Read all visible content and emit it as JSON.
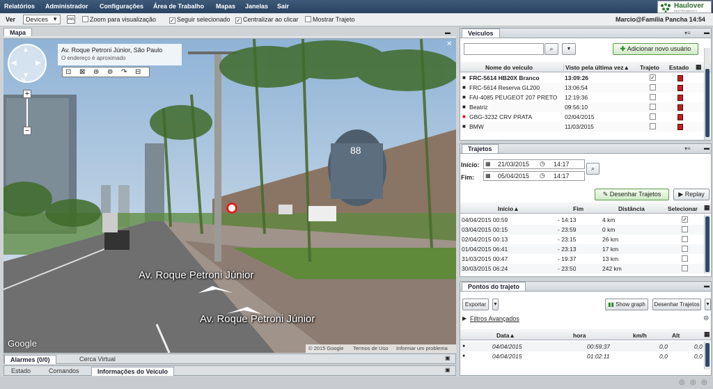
{
  "menubar": {
    "items": [
      "Relatórios",
      "Administrador",
      "Configurações",
      "Área de Trabalho",
      "Mapas",
      "Janelas",
      "Sair"
    ],
    "brand": "Haulover",
    "brand_sub": "RASTREAMENTO"
  },
  "toolbar": {
    "ver_label": "Ver",
    "devices_value": "Devices",
    "zoom_label": "Zoom para visualização",
    "seguir_label": "Seguir selecionado",
    "centralizar_label": "Centralizar ao clicar",
    "mostrar_label": "Mostrar Trajeto",
    "user_time": "Marcio@Família Pancha 14:54"
  },
  "map": {
    "tab": "Mapa",
    "address_title": "Av. Roque Petroni Júnior, São Paulo",
    "address_note": "O endereço é aproximado",
    "road_label_1": "Av. Roque Petroni Júnior",
    "road_label_2": "Av. Roque Petroni Júnior",
    "google": "Google",
    "copyright": "© 2015 Google",
    "terms": "Termos de Uso",
    "report": "Informar um problema",
    "compass_n": "N"
  },
  "bottom_left": {
    "tabs_top": [
      "Alarmes (0/0)",
      "Cerca Virtual"
    ],
    "tabs_bottom": [
      "Estado",
      "Comandos",
      "Informações do Veículo"
    ]
  },
  "veiculos": {
    "tab": "Veículos",
    "add_button": "Adicionar novo usuário",
    "headers": [
      "Nome do veículo",
      "Visto pela última vez▲",
      "Trajeto",
      "Estado"
    ],
    "rows": [
      {
        "name": "FRC-5614 HB20X Branco",
        "time": "13:09:26",
        "checked": true,
        "bold": true
      },
      {
        "name": "FRC-5614 Reserva GL200",
        "time": "13:06:54",
        "checked": false,
        "bold": false
      },
      {
        "name": "FAI-4085 PEUGEOT 207 PRETO",
        "time": "12:19:36",
        "checked": false,
        "bold": false
      },
      {
        "name": "Beatriz",
        "time": "09:56:10",
        "checked": false,
        "bold": false
      },
      {
        "name": "GBG-3232 CRV PRATA",
        "time": "02/04/2015",
        "checked": false,
        "bold": false
      },
      {
        "name": "BMW",
        "time": "11/03/2015",
        "checked": false,
        "bold": false
      }
    ]
  },
  "trajetos": {
    "tab": "Trajetos",
    "inicio_label": "Início:",
    "fim_label": "Fim:",
    "inicio_date": "21/03/2015",
    "inicio_time": "14:17",
    "fim_date": "05/04/2015",
    "fim_time": "14:17",
    "draw_button": "Desenhar Trajetos",
    "replay_button": "Replay",
    "headers": [
      "Início▲",
      "Fim",
      "Distância",
      "Selecionar"
    ],
    "rows": [
      {
        "inicio": "04/04/2015 00:59",
        "fim": "- 14:13",
        "dist": "4 km",
        "checked": true
      },
      {
        "inicio": "03/04/2015 00:15",
        "fim": "- 23:59",
        "dist": "0 km",
        "checked": false
      },
      {
        "inicio": "02/04/2015 00:13",
        "fim": "- 23:15",
        "dist": "26 km",
        "checked": false
      },
      {
        "inicio": "01/04/2015 06:41",
        "fim": "- 23:13",
        "dist": "17 km",
        "checked": false
      },
      {
        "inicio": "31/03/2015 00:47",
        "fim": "- 19:37",
        "dist": "13 km",
        "checked": false
      },
      {
        "inicio": "30/03/2015 06:24",
        "fim": "- 23:50",
        "dist": "242 km",
        "checked": false
      }
    ]
  },
  "pontos": {
    "tab": "Pontos do trajeto",
    "exportar": "Exportar",
    "show_graph": "Show graph",
    "desenhar": "Desenhar Trajetos",
    "filtros": "Filtros Avançados",
    "headers": [
      "Data▲",
      "hora",
      "km/h",
      "Alt"
    ],
    "rows": [
      {
        "data": "04/04/2015",
        "hora": "00:59:37",
        "kmh": "0,0",
        "alt": "0,0"
      },
      {
        "data": "04/04/2015",
        "hora": "01:02:11",
        "kmh": "0,0",
        "alt": "0,0"
      }
    ]
  }
}
